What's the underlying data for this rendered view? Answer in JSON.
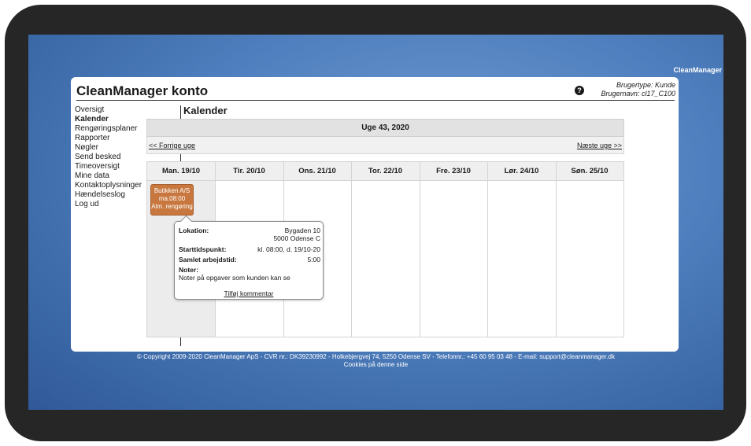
{
  "brand": "CleanManager",
  "header": {
    "title": "CleanManager konto",
    "user_type": "Brugertype: Kunde",
    "user_name": "Brugernavn: cl17_C100"
  },
  "sidebar": {
    "items": [
      {
        "label": "Oversigt"
      },
      {
        "label": "Kalender"
      },
      {
        "label": "Rengøringsplaner"
      },
      {
        "label": "Rapporter"
      },
      {
        "label": "Nøgler"
      },
      {
        "label": "Send besked"
      },
      {
        "label": "Timeoversigt"
      },
      {
        "label": "Mine data"
      },
      {
        "label": "Kontaktoplysninger"
      },
      {
        "label": "Hændelseslog"
      },
      {
        "label": "Log ud"
      }
    ],
    "active": "Kalender"
  },
  "main": {
    "title": "Kalender",
    "week_label": "Uge 43, 2020",
    "prev_week": "<< Forrige uge",
    "next_week": "Næste uge >>",
    "days": [
      "Man. 19/10",
      "Tir. 20/10",
      "Ons. 21/10",
      "Tor. 22/10",
      "Fre. 23/10",
      "Lør. 24/10",
      "Søn. 25/10"
    ]
  },
  "event": {
    "name": "Butikken A/S",
    "time": "ma.08:00",
    "type": "Alm. rengøring",
    "color": "#c8783f"
  },
  "popup": {
    "location_label": "Lokation:",
    "location_line1": "Bygaden 10",
    "location_line2": "5000 Odense C",
    "start_label": "Starttidspunkt:",
    "start_value": "kl. 08:00, d. 19/10-20",
    "work_label": "Samlet arbejdstid:",
    "work_value": "5:00",
    "notes_label": "Noter:",
    "notes_value": "Noter på opgaver som kunden kan se",
    "comment_link": "Tilføj kommentar"
  },
  "footer": {
    "copyright": "© Copyright 2009-2020 CleanManager ApS - CVR nr.: DK39230992 - Holkebjergvej 74, 5250 Odense SV - Telefonnr.: +45 60 95 03 48 - E-mail: support@cleanmanager.dk",
    "cookies": "Cookies på denne side"
  },
  "icons": {
    "help": "help-icon"
  }
}
